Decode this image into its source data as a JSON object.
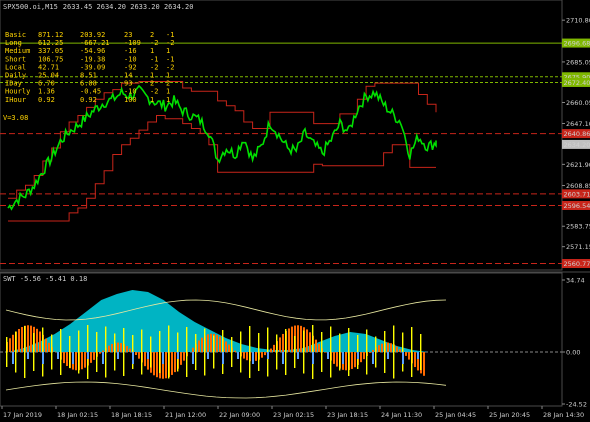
{
  "header": {
    "symbol": "SPX500.oi,M15",
    "ohlc": "2633.45 2634.20 2633.20 2634.20"
  },
  "stats_table": [
    {
      "label": "Basic",
      "v1": "871.12",
      "v2": "203.92",
      "v3": "23",
      "v4": "2",
      "v5": "-1"
    },
    {
      "label": "Long",
      "v1": "612.25",
      "v2": "-667.21",
      "v3": "-109",
      "v4": "-2",
      "v5": "-2"
    },
    {
      "label": "Medium",
      "v1": "337.05",
      "v2": "-54.96",
      "v3": "-16",
      "v4": "1",
      "v5": "1"
    },
    {
      "label": "Short",
      "v1": "106.75",
      "v2": "-19.38",
      "v3": "-10",
      "v4": "-1",
      "v5": "-1"
    },
    {
      "label": "Local",
      "v1": "42.71",
      "v2": "-39.09",
      "v3": "-92",
      "v4": "-2",
      "v5": "-2"
    },
    {
      "label": "Daily",
      "v1": "25.04",
      "v2": "8.51",
      "v3": "14",
      "v4": "1",
      "v5": "1"
    },
    {
      "label": "IDay",
      "v1": "6.70",
      "v2": "6.08",
      "v3": "93",
      "v4": "2",
      "v5": "2"
    },
    {
      "label": "Hourly",
      "v1": "1.36",
      "v2": "-0.45",
      "v3": "-10",
      "v4": "-2",
      "v5": "1"
    },
    {
      "label": "IHour",
      "v1": "0.92",
      "v2": "0.92",
      "v3": "100",
      "v4": "1",
      "v5": "1"
    }
  ],
  "volatility_label": "V=3.08",
  "indicator_header": "SWT -5.56 -5.41 0.18",
  "price_axis_ticks": [
    "2710.80",
    "2685.05",
    "2660.05",
    "2647.10",
    "2621.90",
    "2608.85",
    "2583.75",
    "2571.15"
  ],
  "price_badges": [
    {
      "text": "2696.68",
      "color": "#7fb800"
    },
    {
      "text": "2675.90",
      "color": "#7fb800"
    },
    {
      "text": "2672.40",
      "color": "#7fb800"
    },
    {
      "text": "2640.86",
      "color": "#c8251a"
    },
    {
      "text": "2634.20",
      "color": "#c0c0c0"
    },
    {
      "text": "2603.71",
      "color": "#c8251a"
    },
    {
      "text": "2596.54",
      "color": "#c8251a"
    },
    {
      "text": "2560.77",
      "color": "#c8251a"
    }
  ],
  "indicator_axis_ticks": [
    "34.74",
    "0.00",
    "-24.52"
  ],
  "time_axis_labels": [
    "17 Jan 2019",
    "18 Jan 02:15",
    "18 Jan 18:15",
    "21 Jan 12:00",
    "22 Jan 09:00",
    "23 Jan 02:15",
    "23 Jan 18:15",
    "24 Jan 11:30",
    "25 Jan 04:45",
    "25 Jan 20:45",
    "28 Jan 14:30"
  ],
  "colors": {
    "price_line": "#00e000",
    "support_line": "#7fb800",
    "resistance": "#c8251a",
    "indicator_cyan": "#00c8d8",
    "indicator_orange": "#ff6a00",
    "indicator_yellow": "#ffff00",
    "indicator_blue": "#5aa0ff"
  },
  "chart_data": {
    "type": "line",
    "title": "SPX500.oi,M15",
    "series": [
      {
        "name": "",
        "values": [
          2595,
          2600,
          2603,
          2609,
          2618,
          2626,
          2636,
          2642,
          2646,
          2651,
          2656,
          2660,
          2662,
          2666,
          2664,
          2667,
          2663,
          2660,
          2658,
          2661,
          2655,
          2652,
          2649,
          2642,
          2625,
          2632,
          2628,
          2638,
          2625,
          2633,
          2648,
          2640,
          2632,
          2630,
          2641,
          2634,
          2629,
          2637,
          2647,
          2642,
          2656,
          2664,
          2666,
          2659,
          2653,
          2648,
          2628,
          2639,
          2633,
          2635
        ]
      }
    ],
    "ylim": [
      2558,
      2722
    ],
    "levels": [
      2696.68,
      2675.9,
      2672.4,
      2640.86,
      2634.2,
      2603.71,
      2596.54,
      2560.77
    ],
    "grid": false
  }
}
